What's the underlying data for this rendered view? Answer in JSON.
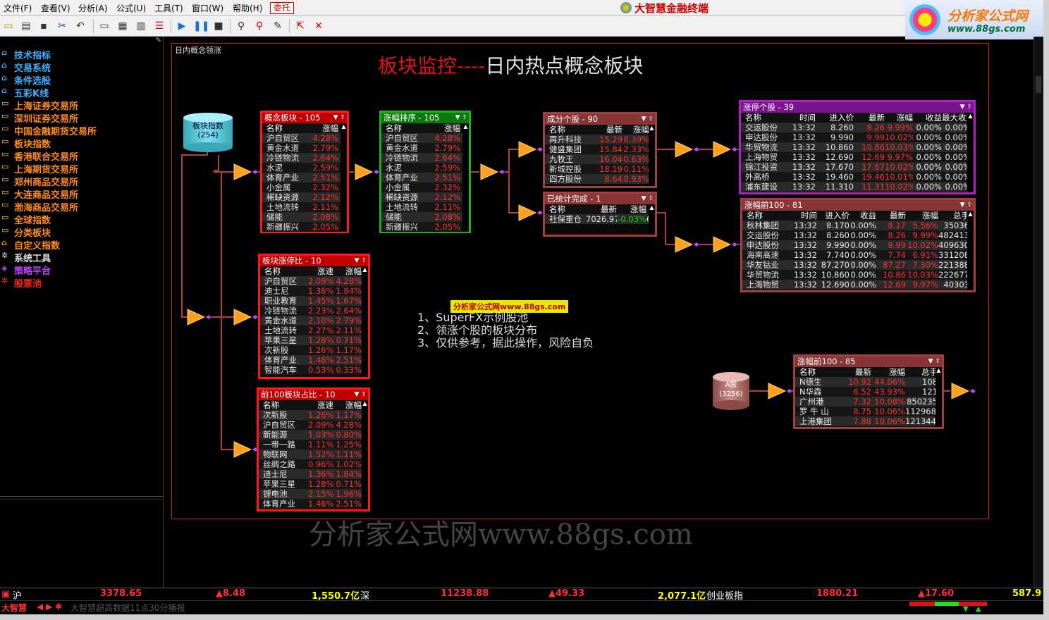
{
  "menu": [
    "文件(F)",
    "查看(V)",
    "分析(A)",
    "公式(U)",
    "工具(T)",
    "窗口(W)",
    "帮助(H)"
  ],
  "menu_entrust": "委托",
  "brand": "大智慧金融终端",
  "logo": {
    "title": "分析家公式网",
    "url": "www.88gs.com"
  },
  "sidebar": [
    {
      "label": "技术指标",
      "color": "#3fb0ff",
      "icon": "home-icon"
    },
    {
      "label": "交易系统",
      "color": "#3fb0ff",
      "icon": "home-icon"
    },
    {
      "label": "条件选股",
      "color": "#3fb0ff",
      "icon": "home-icon"
    },
    {
      "label": "五彩K线",
      "color": "#3fb0ff",
      "icon": "home-icon"
    },
    {
      "label": "上海证券交易所",
      "color": "#ff8c1a",
      "icon": "folder-icon"
    },
    {
      "label": "深圳证券交易所",
      "color": "#ff8c1a",
      "icon": "folder-icon"
    },
    {
      "label": "中国金融期货交易所",
      "color": "#ff8c1a",
      "icon": "folder-icon"
    },
    {
      "label": "板块指数",
      "color": "#ff8c1a",
      "icon": "folder-icon"
    },
    {
      "label": "香港联合交易所",
      "color": "#ff8c1a",
      "icon": "folder-icon"
    },
    {
      "label": "上海期货交易所",
      "color": "#ff8c1a",
      "icon": "folder-icon"
    },
    {
      "label": "郑州商品交易所",
      "color": "#ff8c1a",
      "icon": "folder-icon"
    },
    {
      "label": "大连商品交易所",
      "color": "#ff8c1a",
      "icon": "folder-icon"
    },
    {
      "label": "渤海商品交易所",
      "color": "#ff8c1a",
      "icon": "folder-icon"
    },
    {
      "label": "全球指数",
      "color": "#ff8c1a",
      "icon": "folder-icon"
    },
    {
      "label": "分类板块",
      "color": "#ff8c1a",
      "icon": "folder-icon"
    },
    {
      "label": "自定义指数",
      "color": "#ff8c1a",
      "icon": "home-icon"
    },
    {
      "label": "系统工具",
      "color": "#e0e0e0",
      "icon": "gear-icon"
    },
    {
      "label": "策略平台",
      "color": "#c040ff",
      "icon": "diamond-icon"
    },
    {
      "label": "股票池",
      "color": "#ff2020",
      "icon": "gear-icon"
    }
  ],
  "canvas_label": "日内概念领涨",
  "page_title": {
    "red": "板块监控----",
    "white": "日内热点概念板块"
  },
  "cyl_sector": {
    "line1": "板块指数",
    "line2": "(254)"
  },
  "cyl_a": {
    "line1": "A股",
    "line2": "(3256)"
  },
  "notes": [
    "1、SuperFX示例股池",
    "2、领涨个股的板块分布",
    "3、仅供参考，据此操作，风险自负"
  ],
  "tag88": "分析家公式网www.88gs.com",
  "watermark": "分析家公式网www.88gs.com",
  "panels": {
    "p1": {
      "title": "概念板块 - 105",
      "cols": [
        "名称",
        "涨幅"
      ],
      "rows": [
        [
          "沪自贸区",
          "4.28%"
        ],
        [
          "黄金水道",
          "2.79%"
        ],
        [
          "冷链物流",
          "2.64%"
        ],
        [
          "水泥",
          "2.59%"
        ],
        [
          "体育产业",
          "2.51%"
        ],
        [
          "小金属",
          "2.32%"
        ],
        [
          "稀缺资源",
          "2.12%"
        ],
        [
          "土地流转",
          "2.11%"
        ],
        [
          "储能",
          "2.08%"
        ],
        [
          "新疆振兴",
          "2.05%"
        ]
      ]
    },
    "p2": {
      "title": "涨幅排序 - 105",
      "cols": [
        "名称",
        "涨幅"
      ],
      "rows": [
        [
          "沪自贸区",
          "4.28%"
        ],
        [
          "黄金水道",
          "2.79%"
        ],
        [
          "冷链物流",
          "2.64%"
        ],
        [
          "水泥",
          "2.59%"
        ],
        [
          "体育产业",
          "2.51%"
        ],
        [
          "小金属",
          "2.32%"
        ],
        [
          "稀缺资源",
          "2.12%"
        ],
        [
          "土地流转",
          "2.11%"
        ],
        [
          "储能",
          "2.08%"
        ],
        [
          "新疆振兴",
          "2.05%"
        ]
      ]
    },
    "p3": {
      "title": "板块涨停比 - 10",
      "cols": [
        "名称",
        "涨速",
        "涨幅"
      ],
      "rows": [
        [
          "沪自贸区",
          "2.09%",
          "4.28%"
        ],
        [
          "迪士尼",
          "1.36%",
          "1.84%"
        ],
        [
          "职业教育",
          "1.45%",
          "1.67%"
        ],
        [
          "冷链物流",
          "2.23%",
          "2.64%"
        ],
        [
          "黄金水道",
          "2.10%",
          "2.79%"
        ],
        [
          "土地流转",
          "2.27%",
          "2.11%"
        ],
        [
          "苹果三星",
          "1.28%",
          "0.71%"
        ],
        [
          "次新股",
          "1.26%",
          "1.17%"
        ],
        [
          "体育产业",
          "1.46%",
          "2.51%"
        ],
        [
          "智能汽车",
          "0.53%",
          "0.33%"
        ]
      ]
    },
    "p4": {
      "title": "前100板块占比 - 10",
      "cols": [
        "名称",
        "涨速",
        "涨幅"
      ],
      "rows": [
        [
          "次新股",
          "1.26%",
          "1.17%"
        ],
        [
          "沪自贸区",
          "2.09%",
          "4.28%"
        ],
        [
          "新能源",
          "1.03%",
          "0.80%"
        ],
        [
          "一带一路",
          "1.11%",
          "1.25%"
        ],
        [
          "物联网",
          "1.52%",
          "1.11%"
        ],
        [
          "丝绸之路",
          "0.96%",
          "1.02%"
        ],
        [
          "迪士尼",
          "1.36%",
          "1.84%"
        ],
        [
          "苹果三星",
          "1.28%",
          "0.71%"
        ],
        [
          "锂电池",
          "2.15%",
          "1.96%"
        ],
        [
          "体育产业",
          "1.46%",
          "2.51%"
        ]
      ]
    },
    "p5": {
      "title": "成分个股 - 90",
      "cols": [
        "名称",
        "最新",
        "涨幅"
      ],
      "rows": [
        [
          "再升科技",
          "15.29",
          "0.39%"
        ],
        [
          "健盛集团",
          "15.84",
          "2.33%"
        ],
        [
          "九牧王",
          "16.04",
          "0.63%"
        ],
        [
          "新城控股",
          "18.19",
          "0.11%"
        ],
        [
          "四方股份",
          "8.64",
          "0.93%"
        ]
      ]
    },
    "p6": {
      "title": "已统计完成 - 1",
      "cols": [
        "名称",
        "最新",
        "涨幅"
      ],
      "rows": [
        [
          "社保重仓",
          "7026.97",
          "-0.03%",
          "63"
        ]
      ]
    },
    "p7": {
      "title": "涨停个股 - 39",
      "cols": [
        "名称",
        "时间",
        "进入价",
        "最新",
        "涨幅",
        "收益",
        "最大收益"
      ],
      "rows": [
        [
          "交运股份",
          "13:32",
          "8.260",
          "8.26",
          "9.99%",
          "0.00%",
          "0.00%"
        ],
        [
          "申达股份",
          "13:32",
          "9.990",
          "9.99",
          "10.02%",
          "0.00%",
          "0.00%"
        ],
        [
          "华贸物流",
          "13:32",
          "10.860",
          "10.86",
          "10.03%",
          "0.00%",
          "0.00%"
        ],
        [
          "上海物贸",
          "13:32",
          "12.690",
          "12.69",
          "9.97%",
          "0.00%",
          "0.00%"
        ],
        [
          "锦江投资",
          "13:32",
          "17.670",
          "17.67",
          "10.02%",
          "0.00%",
          "0.00%"
        ],
        [
          "外高桥",
          "13:32",
          "19.460",
          "19.46",
          "10.01%",
          "0.00%",
          "0.00%"
        ],
        [
          "浦东建设",
          "13:32",
          "11.310",
          "11.31",
          "10.02%",
          "0.00%",
          "0.00%"
        ]
      ]
    },
    "p8": {
      "title": "涨幅前100 - 81",
      "cols": [
        "名称",
        "时间",
        "进入价",
        "收益",
        "最新",
        "涨幅",
        "总手"
      ],
      "rows": [
        [
          "秋林集团",
          "13:32",
          "8.170",
          "0.00%",
          "8.17",
          "5.56%",
          "35036"
        ],
        [
          "交运股份",
          "13:32",
          "8.260",
          "0.00%",
          "8.26",
          "9.99%",
          "482413"
        ],
        [
          "申达股份",
          "13:32",
          "9.990",
          "0.00%",
          "9.99",
          "10.02%",
          "409630"
        ],
        [
          "海南高速",
          "13:32",
          "7.740",
          "0.00%",
          "7.74",
          "6.91%",
          "331208"
        ],
        [
          "华友钴业",
          "13:32",
          "87.270",
          "0.00%",
          "87.27",
          "7.30%",
          "221388"
        ],
        [
          "华贸物流",
          "13:32",
          "10.860",
          "0.00%",
          "10.86",
          "10.03%",
          "222677"
        ],
        [
          "上海物贸",
          "13:32",
          "12.690",
          "0.00%",
          "12.69",
          "9.97%",
          "40303"
        ]
      ]
    },
    "p9": {
      "title": "涨幅前100 - 85",
      "cols": [
        "名称",
        "最新",
        "涨幅",
        "总手"
      ],
      "rows": [
        [
          "N德生",
          "10.92",
          "44.06%",
          "108"
        ],
        [
          "N华森",
          "6.52",
          "43.93%",
          "121"
        ],
        [
          "广州港",
          "7.32",
          "10.08%",
          "850235"
        ],
        [
          "罗 牛 山",
          "8.75",
          "10.06%",
          "1129689"
        ],
        [
          "上港集团",
          "7.88",
          "10.06%",
          "1213446"
        ]
      ]
    }
  },
  "status": [
    {
      "name": "沪",
      "value": "3378.65",
      "change": "▲8.48",
      "amount": "1,550.7亿"
    },
    {
      "name": "深",
      "value": "11238.88",
      "change": "▲49.33",
      "amount": "2,077.1亿"
    },
    {
      "name": "创业板指",
      "value": "1880.21",
      "change": "▲17.60",
      "amount": "587.9"
    }
  ],
  "bottom": {
    "brand": "大智慧",
    "ticker": "大智慧超高数据11点30分播报"
  }
}
